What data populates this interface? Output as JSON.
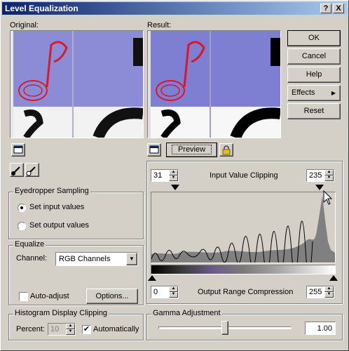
{
  "window": {
    "title": "Level Equalization",
    "help_btn": "?",
    "close_btn": "X"
  },
  "previews": {
    "original_label": "Original:",
    "result_label": "Result:"
  },
  "buttons": {
    "ok": "OK",
    "cancel": "Cancel",
    "help": "Help",
    "effects": "Effects",
    "reset": "Reset",
    "preview": "Preview",
    "options": "Options..."
  },
  "eyedropper": {
    "title": "Eyedropper Sampling",
    "set_input": "Set input values",
    "set_output": "Set output values",
    "selected": "set_input"
  },
  "equalize": {
    "title": "Equalize",
    "channel_label": "Channel:",
    "channel_value": "RGB Channels",
    "auto_adjust_label": "Auto-adjust",
    "auto_adjust_checked": false
  },
  "histogram_clipping": {
    "title": "Histogram Display Clipping",
    "percent_label": "Percent:",
    "percent_value": "10",
    "automatically_label": "Automatically",
    "automatically_checked": true
  },
  "input_clipping": {
    "label": "Input Value Clipping",
    "low": "31",
    "high": "235"
  },
  "output_compression": {
    "label": "Output Range Compression",
    "low": "0",
    "high": "255"
  },
  "gamma": {
    "title": "Gamma Adjustment",
    "value": "1.00",
    "slider_fraction": 0.5
  },
  "colors": {
    "title_start": "#0a246a",
    "title_end": "#a6caf0",
    "preview_purple": "#8c8cd6",
    "stamp_red": "#d81b2a"
  }
}
